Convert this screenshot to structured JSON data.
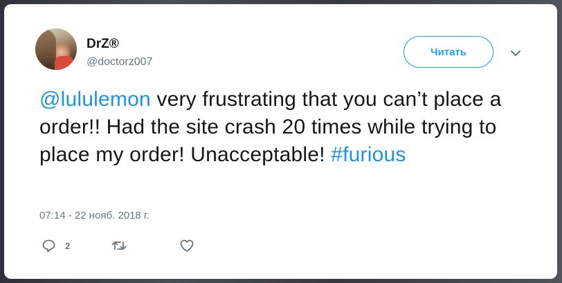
{
  "author": {
    "display_name": "DrZ®",
    "username": "@doctorz007"
  },
  "follow_button": {
    "label": "Читать"
  },
  "tweet": {
    "mention": "@lululemon",
    "text_body": " very frustrating that you can’t place a order!! Had the site crash 20 times while trying to place my order! Unacceptable! ",
    "hashtag": "#furious"
  },
  "timestamp": "07:14 - 22 нояб. 2018 г.",
  "actions": {
    "reply_count": "2"
  },
  "colors": {
    "accent": "#1da1f2",
    "link": "#1b95e0",
    "secondary_text": "#657786",
    "primary_text": "#14171a"
  },
  "icons": {
    "reply": "speech-bubble-icon",
    "retweet": "retweet-icon",
    "like": "heart-icon",
    "menu": "chevron-down-icon"
  }
}
